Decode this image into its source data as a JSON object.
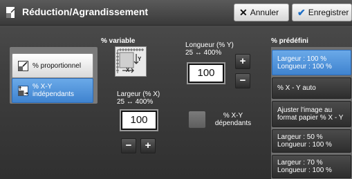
{
  "header": {
    "title": "Réduction/Agrandissement",
    "cancel_label": "Annuler",
    "save_label": "Enregistrer"
  },
  "modes": {
    "proportional_label": "% proportionnel",
    "independent_label": "% X-Y indépendants",
    "selected": "independent"
  },
  "variable": {
    "title": "% variable",
    "diagram_x_label": "X",
    "diagram_y_label": "Y"
  },
  "width": {
    "label": "Largeur (% X)",
    "range": "25 ↔ 400%",
    "value": "100"
  },
  "length": {
    "label": "Longueur (% Y)",
    "range": "25 ↔ 400%",
    "value": "100"
  },
  "dependent": {
    "label": "% X-Y dépendants",
    "checked": false
  },
  "presets": {
    "title": "% prédéfini",
    "items": [
      {
        "line1": "Largeur : 100 %",
        "line2": "Longueur : 100 %",
        "selected": true
      },
      {
        "line1": "% X - Y auto",
        "line2": "",
        "selected": false
      },
      {
        "line1": "Ajuster l'image au",
        "line2": "format papier % X - Y",
        "selected": false
      },
      {
        "line1": "Largeur : 50 %",
        "line2": "Longueur : 100 %",
        "selected": false
      },
      {
        "line1": "Largeur : 70 %",
        "line2": "Longueur : 100 %",
        "selected": false
      }
    ]
  },
  "colors": {
    "accent": "#3f83cf",
    "background": "#3f3f3f"
  }
}
